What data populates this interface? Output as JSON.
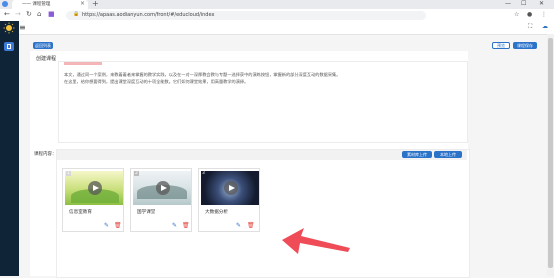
{
  "browser": {
    "tab_title": "一一 课程管理",
    "url": "https://apaas.aodianyun.com/front/#/educloud/index",
    "window_controls": {
      "minimize": "—",
      "maximize": "☐",
      "close": "✕"
    }
  },
  "header": {
    "left_button": "返回列表",
    "preview_button": "预览",
    "save_button": "课程保存"
  },
  "intro_section": {
    "title": "创建课程",
    "text_line1": "本文，通过同一个案例，来教着着者来掌握的教学实践，以及在一对一深厚教会教与专题一选择获中的演练按钮，掌握新的部分深度互动的数据采集。",
    "text_line2": "在这里，给你想要得到，提出课堂深度互动的十项全能数。它们如何课堂效果，用高量教学的演绎。"
  },
  "course_section": {
    "label": "课程内容：",
    "upload_button": "素材库上传",
    "local_upload_button": "本地上传",
    "cards": [
      {
        "number": "1",
        "title": "信息室教育"
      },
      {
        "number": "2",
        "title": "国学课堂"
      },
      {
        "number": "3",
        "title": "大数据分析"
      }
    ]
  },
  "colors": {
    "accent": "#2b72c9",
    "sidebar": "#0f2537",
    "delete": "#e0433a",
    "arrow": "#ef4c57"
  },
  "icons": [
    "back-icon",
    "forward-icon",
    "reload-icon",
    "home-icon",
    "lock-icon",
    "star-icon",
    "menu-icon",
    "edit-icon",
    "delete-icon",
    "play-icon",
    "arrow-annotation-icon"
  ]
}
